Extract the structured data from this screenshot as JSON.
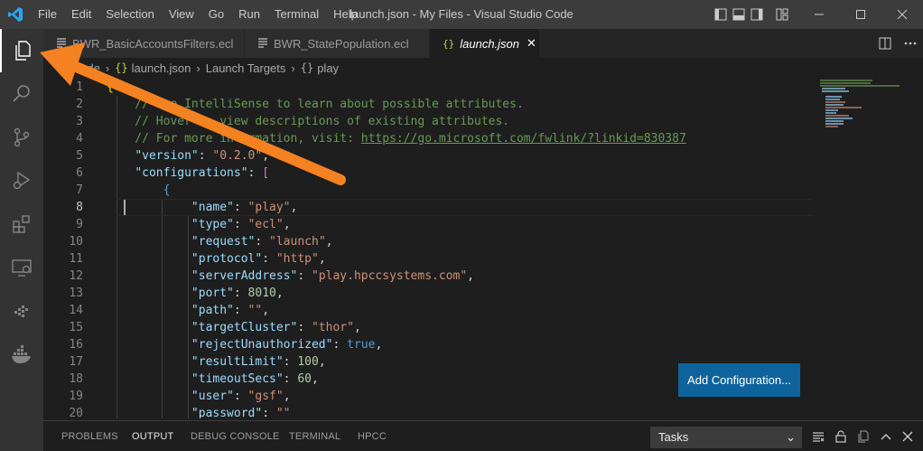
{
  "titlebar": {
    "menu": [
      "File",
      "Edit",
      "Selection",
      "View",
      "Go",
      "Run",
      "Terminal",
      "Help"
    ],
    "window_title": "launch.json - My Files - Visual Studio Code"
  },
  "activitybar": {
    "items": [
      "explorer-icon",
      "search-icon",
      "source-control-icon",
      "run-debug-icon",
      "extensions-icon",
      "remote-explorer-icon",
      "hpcc-icon",
      "docker-icon"
    ]
  },
  "tabs": [
    {
      "label": "BWR_BasicAccountsFilters.ecl",
      "icon": "file-lines-icon"
    },
    {
      "label": "BWR_StatePopulation.ecl",
      "icon": "file-lines-icon"
    },
    {
      "label": "launch.json",
      "icon": "json-icon",
      "active": true
    }
  ],
  "breadcrumb": [
    ".vscode",
    "launch.json",
    "Launch Targets",
    "play"
  ],
  "breadcrumb_braces": "{}",
  "editor": {
    "lines": [
      {
        "n": "1",
        "t": [
          [
            "{",
            "c-brace"
          ]
        ]
      },
      {
        "n": "2",
        "t": [
          [
            "    // Use IntelliSense to learn about possible attributes.",
            "c-comment"
          ]
        ]
      },
      {
        "n": "3",
        "t": [
          [
            "    // Hover to view descriptions of existing attributes.",
            "c-comment"
          ]
        ]
      },
      {
        "n": "4",
        "t": [
          [
            "    // For more information, visit: ",
            "c-comment"
          ],
          [
            "https://go.microsoft.com/fwlink/?linkid=830387",
            "c-comment c-link"
          ]
        ]
      },
      {
        "n": "5",
        "t": [
          [
            "    ",
            ""
          ],
          [
            "\"version\"",
            "c-key"
          ],
          [
            ": ",
            "c-pun"
          ],
          [
            "\"0.2.0\"",
            "c-str"
          ],
          [
            ",",
            "c-pun"
          ]
        ]
      },
      {
        "n": "6",
        "t": [
          [
            "    ",
            ""
          ],
          [
            "\"configurations\"",
            "c-key"
          ],
          [
            ": ",
            "c-pun"
          ],
          [
            "[",
            "c-bracket"
          ]
        ]
      },
      {
        "n": "7",
        "t": [
          [
            "        ",
            ""
          ],
          [
            "{",
            "c-bool"
          ]
        ]
      },
      {
        "n": "8",
        "t": [
          [
            "            ",
            ""
          ],
          [
            "\"name\"",
            "c-key"
          ],
          [
            ": ",
            "c-pun"
          ],
          [
            "\"play\"",
            "c-str"
          ],
          [
            ",",
            "c-pun"
          ]
        ]
      },
      {
        "n": "9",
        "t": [
          [
            "            ",
            ""
          ],
          [
            "\"type\"",
            "c-key"
          ],
          [
            ": ",
            "c-pun"
          ],
          [
            "\"ecl\"",
            "c-str"
          ],
          [
            ",",
            "c-pun"
          ]
        ]
      },
      {
        "n": "10",
        "t": [
          [
            "            ",
            ""
          ],
          [
            "\"request\"",
            "c-key"
          ],
          [
            ": ",
            "c-pun"
          ],
          [
            "\"launch\"",
            "c-str"
          ],
          [
            ",",
            "c-pun"
          ]
        ]
      },
      {
        "n": "11",
        "t": [
          [
            "            ",
            ""
          ],
          [
            "\"protocol\"",
            "c-key"
          ],
          [
            ": ",
            "c-pun"
          ],
          [
            "\"http\"",
            "c-str"
          ],
          [
            ",",
            "c-pun"
          ]
        ]
      },
      {
        "n": "12",
        "t": [
          [
            "            ",
            ""
          ],
          [
            "\"serverAddress\"",
            "c-key"
          ],
          [
            ": ",
            "c-pun"
          ],
          [
            "\"play.hpccsystems.com\"",
            "c-str"
          ],
          [
            ",",
            "c-pun"
          ]
        ]
      },
      {
        "n": "13",
        "t": [
          [
            "            ",
            ""
          ],
          [
            "\"port\"",
            "c-key"
          ],
          [
            ": ",
            "c-pun"
          ],
          [
            "8010",
            "c-num"
          ],
          [
            ",",
            "c-pun"
          ]
        ]
      },
      {
        "n": "14",
        "t": [
          [
            "            ",
            ""
          ],
          [
            "\"path\"",
            "c-key"
          ],
          [
            ": ",
            "c-pun"
          ],
          [
            "\"\"",
            "c-str"
          ],
          [
            ",",
            "c-pun"
          ]
        ]
      },
      {
        "n": "15",
        "t": [
          [
            "            ",
            ""
          ],
          [
            "\"targetCluster\"",
            "c-key"
          ],
          [
            ": ",
            "c-pun"
          ],
          [
            "\"thor\"",
            "c-str"
          ],
          [
            ",",
            "c-pun"
          ]
        ]
      },
      {
        "n": "16",
        "t": [
          [
            "            ",
            ""
          ],
          [
            "\"rejectUnauthorized\"",
            "c-key"
          ],
          [
            ": ",
            "c-pun"
          ],
          [
            "true",
            "c-bool"
          ],
          [
            ",",
            "c-pun"
          ]
        ]
      },
      {
        "n": "17",
        "t": [
          [
            "            ",
            ""
          ],
          [
            "\"resultLimit\"",
            "c-key"
          ],
          [
            ": ",
            "c-pun"
          ],
          [
            "100",
            "c-num"
          ],
          [
            ",",
            "c-pun"
          ]
        ]
      },
      {
        "n": "18",
        "t": [
          [
            "            ",
            ""
          ],
          [
            "\"timeoutSecs\"",
            "c-key"
          ],
          [
            ": ",
            "c-pun"
          ],
          [
            "60",
            "c-num"
          ],
          [
            ",",
            "c-pun"
          ]
        ]
      },
      {
        "n": "19",
        "t": [
          [
            "            ",
            ""
          ],
          [
            "\"user\"",
            "c-key"
          ],
          [
            ": ",
            "c-pun"
          ],
          [
            "\"gsf\"",
            "c-str"
          ],
          [
            ",",
            "c-pun"
          ]
        ]
      },
      {
        "n": "20",
        "t": [
          [
            "            ",
            ""
          ],
          [
            "\"password\"",
            "c-key"
          ],
          [
            ": ",
            "c-pun"
          ],
          [
            "\"\"",
            "c-str"
          ]
        ]
      }
    ],
    "current_line": "8"
  },
  "add_configuration_label": "Add Configuration...",
  "panel": {
    "tabs": [
      "PROBLEMS",
      "OUTPUT",
      "DEBUG CONSOLE",
      "TERMINAL",
      "HPCC"
    ],
    "active_tab": "OUTPUT",
    "tasks_value": "Tasks"
  },
  "colors": {
    "accent": "#0e639c",
    "arrow": "#f58220"
  }
}
